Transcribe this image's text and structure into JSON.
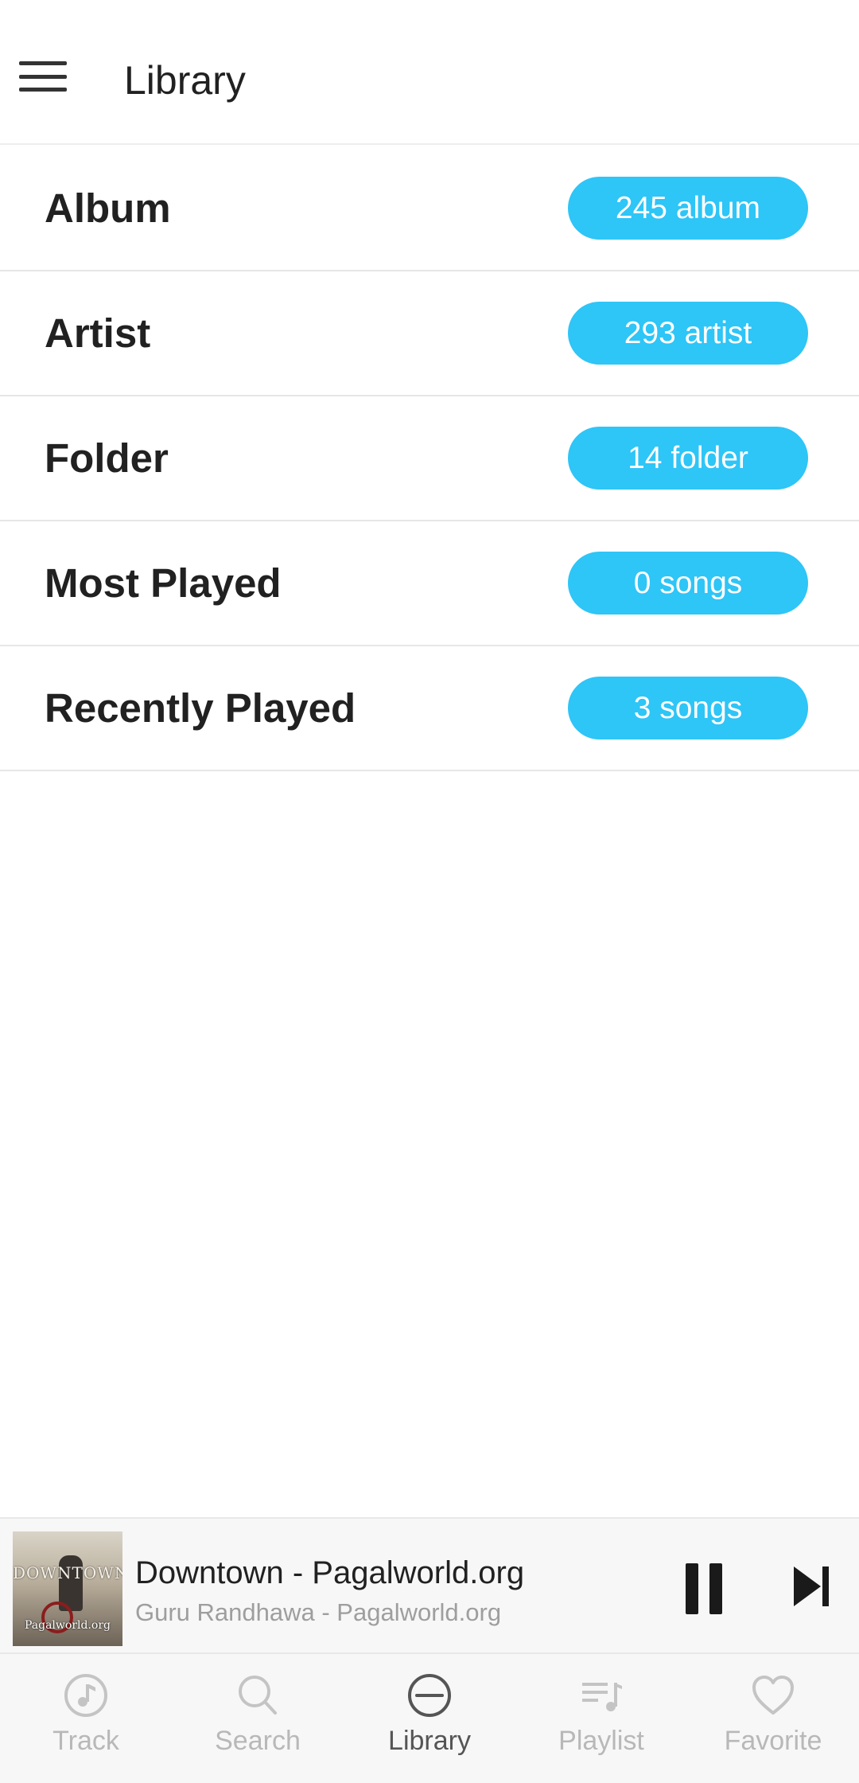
{
  "header": {
    "title": "Library"
  },
  "library": {
    "items": [
      {
        "label": "Album",
        "count": "245 album"
      },
      {
        "label": "Artist",
        "count": "293 artist"
      },
      {
        "label": "Folder",
        "count": "14 folder"
      },
      {
        "label": "Most Played",
        "count": "0 songs"
      },
      {
        "label": "Recently Played",
        "count": "3 songs"
      }
    ],
    "badge_color": "#2ec5f7"
  },
  "player": {
    "title": "Downtown - Pagalworld.org",
    "subtitle": "Guru Randhawa - Pagalworld.org",
    "art_text": "DOWNTOWN",
    "art_site": "Pagalworld.org",
    "state": "playing"
  },
  "nav": {
    "items": [
      {
        "label": "Track",
        "icon": "music-note-icon"
      },
      {
        "label": "Search",
        "icon": "search-icon"
      },
      {
        "label": "Library",
        "icon": "library-icon",
        "active": true
      },
      {
        "label": "Playlist",
        "icon": "playlist-icon"
      },
      {
        "label": "Favorite",
        "icon": "heart-icon"
      }
    ]
  }
}
